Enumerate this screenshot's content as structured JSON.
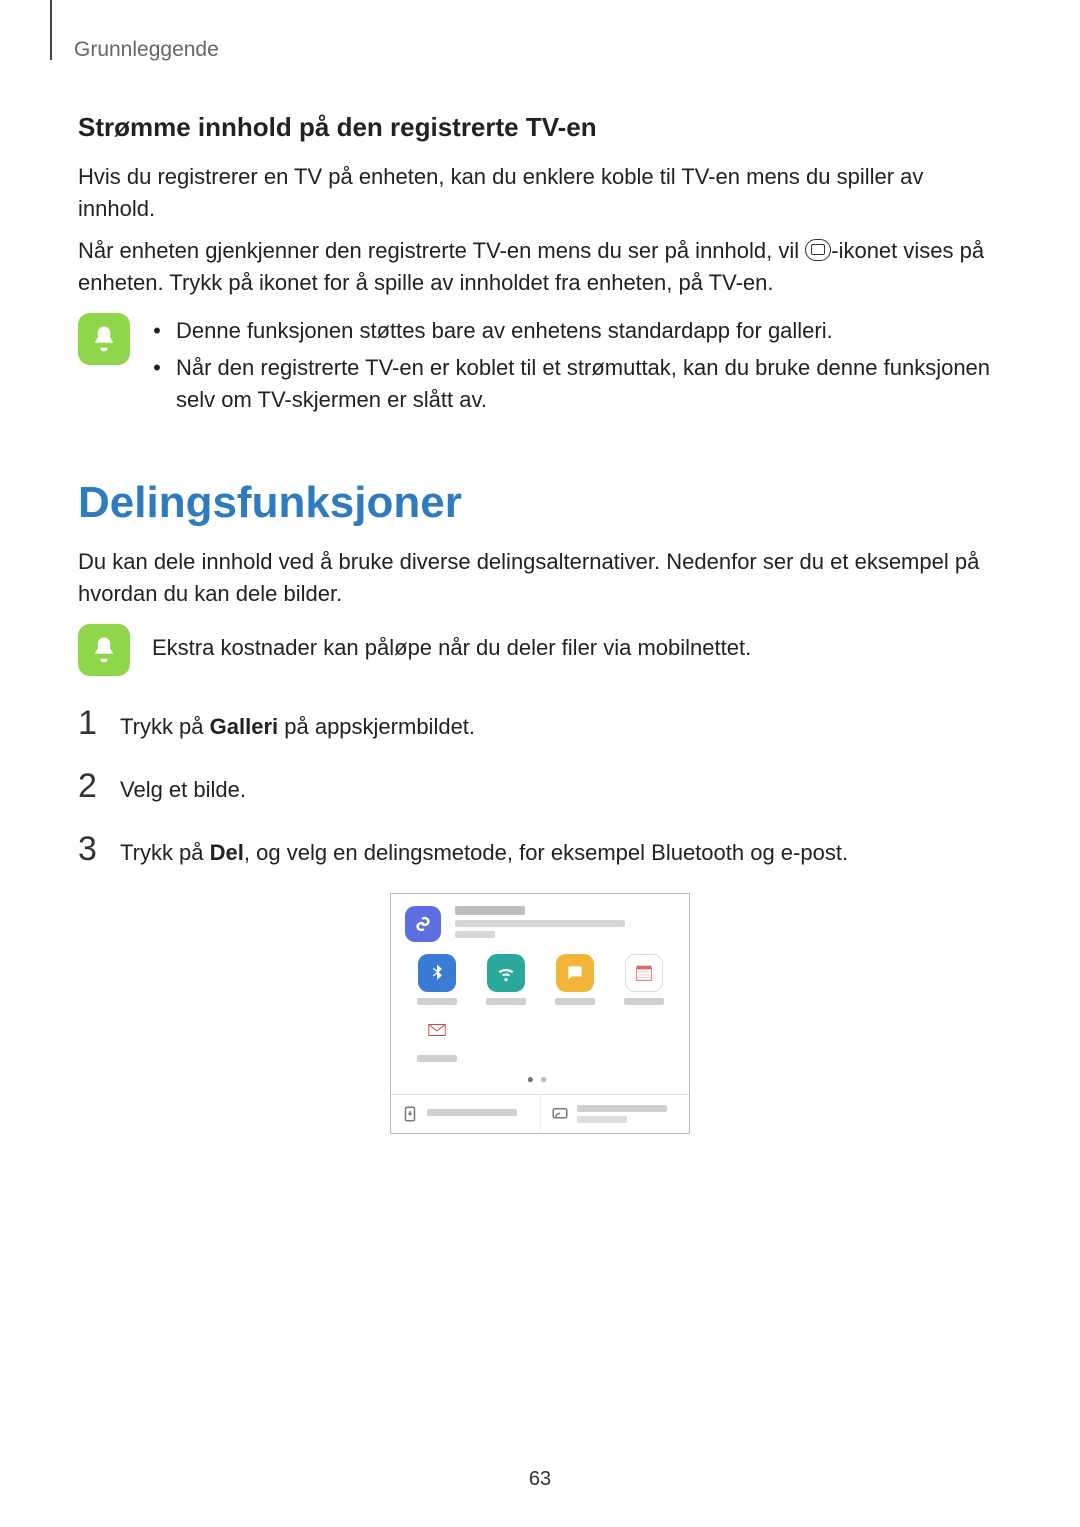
{
  "header": {
    "breadcrumb": "Grunnleggende"
  },
  "section1": {
    "heading": "Strømme innhold på den registrerte TV-en",
    "p1": "Hvis du registrerer en TV på enheten, kan du enklere koble til TV-en mens du spiller av innhold.",
    "p2a": "Når enheten gjenkjenner den registrerte TV-en mens du ser på innhold, vil ",
    "p2b": "-ikonet vises på enheten. Trykk på ikonet for å spille av innholdet fra enheten, på TV-en.",
    "note": {
      "bullets": [
        "Denne funksjonen støttes bare av enhetens standardapp for galleri.",
        "Når den registrerte TV-en er koblet til et strømuttak, kan du bruke denne funksjonen selv om TV-skjermen er slått av."
      ]
    }
  },
  "section2": {
    "title": "Delingsfunksjoner",
    "intro": "Du kan dele innhold ved å bruke diverse delingsalternativer. Nedenfor ser du et eksempel på hvordan du kan dele bilder.",
    "note": "Ekstra kostnader kan påløpe når du deler filer via mobilnettet.",
    "steps": [
      {
        "num": "1",
        "pre": "Trykk på ",
        "bold": "Galleri",
        "post": " på appskjermbildet."
      },
      {
        "num": "2",
        "pre": "Velg et bilde.",
        "bold": "",
        "post": ""
      },
      {
        "num": "3",
        "pre": "Trykk på ",
        "bold": "Del",
        "post": ", og velg en delingsmetode, for eksempel Bluetooth og e-post."
      }
    ],
    "figure": {
      "icons": [
        "link-share-icon",
        "bluetooth-icon",
        "wifi-direct-icon",
        "messages-icon",
        "memo-icon",
        "email-icon"
      ]
    }
  },
  "page_number": "63"
}
